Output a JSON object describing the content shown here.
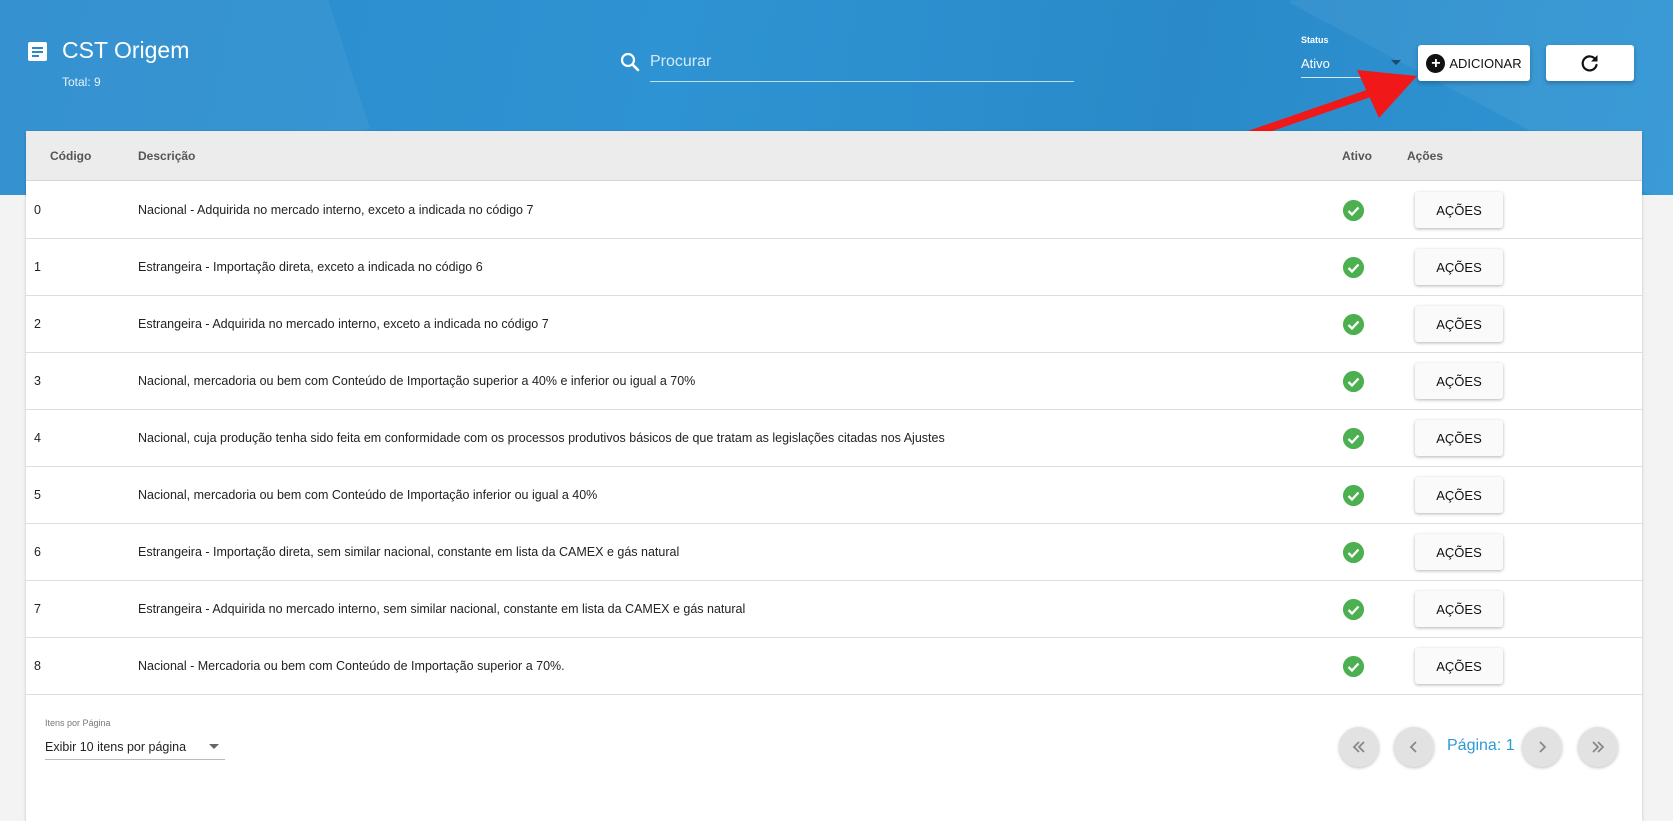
{
  "header": {
    "title": "CST Origem",
    "total": "Total: 9",
    "search_placeholder": "Procurar",
    "status_label": "Status",
    "status_value": "Ativo",
    "add_label": "ADICIONAR"
  },
  "table": {
    "columns": [
      "Código",
      "Descrição",
      "Ativo",
      "Ações"
    ],
    "action_label": "AÇÕES",
    "rows": [
      {
        "codigo": "0",
        "descricao": "Nacional - Adquirida no mercado interno, exceto a indicada no código 7",
        "ativo": true
      },
      {
        "codigo": "1",
        "descricao": "Estrangeira - Importação direta, exceto a indicada no código 6",
        "ativo": true
      },
      {
        "codigo": "2",
        "descricao": "Estrangeira - Adquirida no mercado interno, exceto a indicada no código 7",
        "ativo": true
      },
      {
        "codigo": "3",
        "descricao": "Nacional, mercadoria ou bem com Conteúdo de Importação superior a 40% e inferior ou igual a 70%",
        "ativo": true
      },
      {
        "codigo": "4",
        "descricao": "Nacional, cuja produção tenha sido feita em conformidade com os processos produtivos básicos de que tratam as legislações citadas nos Ajustes",
        "ativo": true
      },
      {
        "codigo": "5",
        "descricao": "Nacional, mercadoria ou bem com Conteúdo de Importação inferior ou igual a 40%",
        "ativo": true
      },
      {
        "codigo": "6",
        "descricao": "Estrangeira - Importação direta, sem similar nacional, constante em lista da CAMEX e gás natural",
        "ativo": true
      },
      {
        "codigo": "7",
        "descricao": "Estrangeira - Adquirida no mercado interno, sem similar nacional, constante em lista da CAMEX e gás natural",
        "ativo": true
      },
      {
        "codigo": "8",
        "descricao": "Nacional - Mercadoria ou bem com Conteúdo de Importação superior a 70%.",
        "ativo": true
      }
    ]
  },
  "pagination": {
    "items_label": "Itens por Página",
    "items_value": "Exibir 10 itens por página",
    "page_text": "Página: 1"
  },
  "colors": {
    "header_blue": "#2b8ccd",
    "check_green": "#4caf50",
    "page_link": "#2c9ad8",
    "annotation_arrow": "#f01818"
  }
}
